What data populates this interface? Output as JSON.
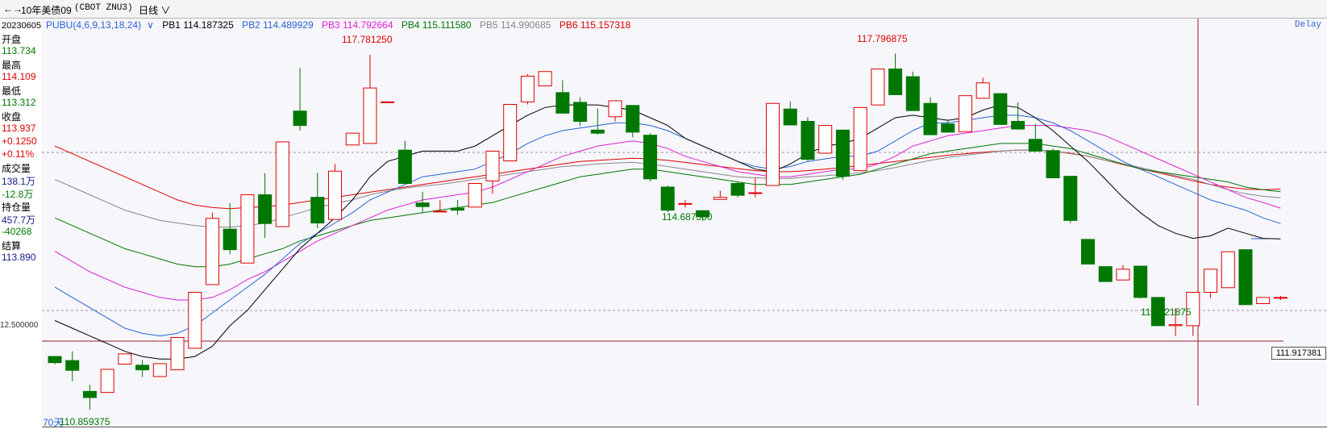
{
  "toolbar": {
    "instrument": "10年美债09",
    "code": "(CBOT ZNU3)",
    "period": "日线"
  },
  "info_panel": {
    "date": "20230605",
    "open_label": "开盘",
    "open_value": "113.734",
    "high_label": "最高",
    "high_value": "114.109",
    "low_label": "最低",
    "low_value": "113.312",
    "close_label": "收盘",
    "close_value": "113.937",
    "change": "+0.1250",
    "change_pct": "+0.11%",
    "volume_label": "成交量",
    "volume_value": "138.1万",
    "volume_change": "-12.8万",
    "oi_label": "持仓量",
    "oi_value": "457.7万",
    "oi_change": "-40268",
    "settle_label": "结算",
    "settle_value": "113.890"
  },
  "legend": {
    "name": "PUBU(4,6,9,13,18,24)",
    "pb1": "PB1 114.187325",
    "pb2": "PB2 114.489929",
    "pb3": "PB3 114.792664",
    "pb4": "PB4 115.111580",
    "pb5": "PB5 114.990685",
    "pb6": "PB6 115.157318"
  },
  "annotations": {
    "high1": "117.781250",
    "high2": "117.796875",
    "low_mid": "114.687500",
    "low_right": "112.921875",
    "low_left": "110.859375",
    "days_label": "70天",
    "axis_tick": "12.500000",
    "current_price": "111.917381",
    "delay": "Delay"
  },
  "colors": {
    "up": "#e00000",
    "down": "#007700",
    "pb1": "#000000",
    "pb2": "#2a64d6",
    "pb3": "#e020d0",
    "pb4": "#007700",
    "pb5": "#888888",
    "pb6": "#e00000",
    "bg": "#f6f6fb"
  },
  "chart_data": {
    "type": "candlestick",
    "ylim": [
      110.55,
      118.2
    ],
    "candles": [
      {
        "o": 111.9,
        "h": 111.9,
        "l": 111.75,
        "c": 111.78
      },
      {
        "o": 111.82,
        "h": 112.0,
        "l": 111.42,
        "c": 111.63
      },
      {
        "o": 111.22,
        "h": 111.35,
        "l": 110.86,
        "c": 111.1
      },
      {
        "o": 111.2,
        "h": 111.65,
        "l": 111.2,
        "c": 111.65
      },
      {
        "o": 111.75,
        "h": 111.95,
        "l": 111.75,
        "c": 111.95
      },
      {
        "o": 111.73,
        "h": 111.83,
        "l": 111.5,
        "c": 111.64
      },
      {
        "o": 111.51,
        "h": 111.76,
        "l": 111.51,
        "c": 111.76
      },
      {
        "o": 111.64,
        "h": 112.27,
        "l": 111.64,
        "c": 112.27
      },
      {
        "o": 112.06,
        "h": 113.15,
        "l": 112.06,
        "c": 113.15
      },
      {
        "o": 113.3,
        "h": 114.7,
        "l": 113.3,
        "c": 114.59
      },
      {
        "o": 114.38,
        "h": 114.89,
        "l": 113.89,
        "c": 113.98
      },
      {
        "o": 113.72,
        "h": 115.05,
        "l": 113.72,
        "c": 115.05
      },
      {
        "o": 115.05,
        "h": 115.47,
        "l": 114.21,
        "c": 114.49
      },
      {
        "o": 114.43,
        "h": 116.08,
        "l": 114.43,
        "c": 116.08
      },
      {
        "o": 116.68,
        "h": 117.52,
        "l": 116.3,
        "c": 116.4
      },
      {
        "o": 115.0,
        "h": 115.48,
        "l": 114.4,
        "c": 114.5
      },
      {
        "o": 114.57,
        "h": 115.65,
        "l": 114.57,
        "c": 115.51
      },
      {
        "o": 116.02,
        "h": 116.25,
        "l": 116.02,
        "c": 116.25
      },
      {
        "o": 116.05,
        "h": 117.78,
        "l": 116.05,
        "c": 117.13
      },
      {
        "o": 116.86,
        "h": 116.86,
        "l": 116.86,
        "c": 116.86
      },
      {
        "o": 115.92,
        "h": 116.1,
        "l": 115.27,
        "c": 115.27
      },
      {
        "o": 114.89,
        "h": 115.11,
        "l": 114.69,
        "c": 114.82
      },
      {
        "o": 114.73,
        "h": 114.94,
        "l": 114.73,
        "c": 114.73
      },
      {
        "o": 114.79,
        "h": 114.95,
        "l": 114.66,
        "c": 114.75
      },
      {
        "o": 114.81,
        "h": 115.27,
        "l": 114.81,
        "c": 115.27
      },
      {
        "o": 115.32,
        "h": 115.9,
        "l": 115.07,
        "c": 115.9
      },
      {
        "o": 115.71,
        "h": 116.81,
        "l": 115.71,
        "c": 116.81
      },
      {
        "o": 116.86,
        "h": 117.4,
        "l": 116.81,
        "c": 117.36
      },
      {
        "o": 117.17,
        "h": 117.45,
        "l": 117.17,
        "c": 117.45
      },
      {
        "o": 117.04,
        "h": 117.28,
        "l": 116.64,
        "c": 116.64
      },
      {
        "o": 116.85,
        "h": 116.95,
        "l": 116.39,
        "c": 116.48
      },
      {
        "o": 116.31,
        "h": 116.73,
        "l": 116.22,
        "c": 116.25
      },
      {
        "o": 116.57,
        "h": 116.88,
        "l": 116.48,
        "c": 116.88
      },
      {
        "o": 116.79,
        "h": 116.79,
        "l": 116.17,
        "c": 116.27
      },
      {
        "o": 116.21,
        "h": 116.25,
        "l": 115.31,
        "c": 115.36
      },
      {
        "o": 115.2,
        "h": 115.23,
        "l": 114.71,
        "c": 114.75
      },
      {
        "o": 114.88,
        "h": 114.95,
        "l": 114.8,
        "c": 114.88
      },
      {
        "o": 114.74,
        "h": 114.75,
        "l": 114.54,
        "c": 114.62
      },
      {
        "o": 114.96,
        "h": 115.13,
        "l": 114.96,
        "c": 115.0
      },
      {
        "o": 115.27,
        "h": 115.3,
        "l": 115.0,
        "c": 115.04
      },
      {
        "o": 115.09,
        "h": 115.38,
        "l": 115.0,
        "c": 115.09
      },
      {
        "o": 115.23,
        "h": 116.83,
        "l": 115.23,
        "c": 116.83
      },
      {
        "o": 116.72,
        "h": 116.87,
        "l": 116.41,
        "c": 116.41
      },
      {
        "o": 116.48,
        "h": 116.56,
        "l": 115.7,
        "c": 115.74
      },
      {
        "o": 115.86,
        "h": 116.4,
        "l": 115.86,
        "c": 116.4
      },
      {
        "o": 116.31,
        "h": 116.32,
        "l": 115.34,
        "c": 115.41
      },
      {
        "o": 115.52,
        "h": 116.75,
        "l": 115.52,
        "c": 116.75
      },
      {
        "o": 116.8,
        "h": 117.5,
        "l": 116.8,
        "c": 117.5
      },
      {
        "o": 117.5,
        "h": 117.8,
        "l": 117.0,
        "c": 117.0
      },
      {
        "o": 117.35,
        "h": 117.45,
        "l": 116.69,
        "c": 116.69
      },
      {
        "o": 116.83,
        "h": 116.95,
        "l": 116.22,
        "c": 116.22
      },
      {
        "o": 116.43,
        "h": 116.52,
        "l": 116.27,
        "c": 116.27
      },
      {
        "o": 116.28,
        "h": 116.98,
        "l": 116.28,
        "c": 116.98
      },
      {
        "o": 116.93,
        "h": 117.33,
        "l": 116.93,
        "c": 117.23
      },
      {
        "o": 117.02,
        "h": 117.02,
        "l": 116.42,
        "c": 116.42
      },
      {
        "o": 116.48,
        "h": 116.85,
        "l": 116.33,
        "c": 116.33
      },
      {
        "o": 116.13,
        "h": 116.43,
        "l": 115.9,
        "c": 115.9
      },
      {
        "o": 115.91,
        "h": 115.95,
        "l": 115.38,
        "c": 115.38
      },
      {
        "o": 115.41,
        "h": 115.41,
        "l": 114.5,
        "c": 114.55
      },
      {
        "o": 114.18,
        "h": 114.18,
        "l": 113.7,
        "c": 113.7
      },
      {
        "o": 113.65,
        "h": 113.65,
        "l": 113.36,
        "c": 113.36
      },
      {
        "o": 113.39,
        "h": 113.68,
        "l": 113.39,
        "c": 113.6
      },
      {
        "o": 113.66,
        "h": 113.66,
        "l": 113.03,
        "c": 113.05
      },
      {
        "o": 113.05,
        "h": 113.05,
        "l": 112.5,
        "c": 112.5
      },
      {
        "o": 112.5,
        "h": 112.84,
        "l": 112.3,
        "c": 112.52
      },
      {
        "o": 112.5,
        "h": 113.15,
        "l": 112.3,
        "c": 113.15
      },
      {
        "o": 113.15,
        "h": 113.6,
        "l": 113.04,
        "c": 113.6
      },
      {
        "o": 113.24,
        "h": 113.94,
        "l": 113.24,
        "c": 113.94
      },
      {
        "o": 113.98,
        "h": 113.98,
        "l": 112.91,
        "c": 112.91
      },
      {
        "o": 112.93,
        "h": 113.03,
        "l": 112.93,
        "c": 113.05
      },
      {
        "o": 113.05,
        "h": 113.08,
        "l": 113.0,
        "c": 113.05
      }
    ],
    "lines": {
      "PB1": [
        112.6,
        112.45,
        112.3,
        112.15,
        112.0,
        111.9,
        111.85,
        111.85,
        111.9,
        112.1,
        112.5,
        112.8,
        113.2,
        113.6,
        114.0,
        114.3,
        114.6,
        114.95,
        115.4,
        115.7,
        115.8,
        115.9,
        115.9,
        115.9,
        116.0,
        116.2,
        116.4,
        116.6,
        116.75,
        116.8,
        116.8,
        116.8,
        116.75,
        116.7,
        116.55,
        116.4,
        116.15,
        116.0,
        115.85,
        115.7,
        115.55,
        115.5,
        115.65,
        115.85,
        116.0,
        116.05,
        116.15,
        116.35,
        116.55,
        116.6,
        116.55,
        116.5,
        116.55,
        116.7,
        116.8,
        116.75,
        116.55,
        116.3,
        116.0,
        115.7,
        115.35,
        115.0,
        114.7,
        114.45,
        114.3,
        114.2,
        114.25,
        114.4,
        114.3,
        114.2,
        114.19
      ],
      "PB2": [
        113.25,
        113.05,
        112.85,
        112.65,
        112.45,
        112.35,
        112.3,
        112.35,
        112.5,
        112.75,
        113.0,
        113.25,
        113.5,
        113.8,
        114.1,
        114.3,
        114.5,
        114.7,
        114.95,
        115.1,
        115.25,
        115.4,
        115.45,
        115.5,
        115.55,
        115.7,
        115.85,
        116.05,
        116.2,
        116.3,
        116.35,
        116.4,
        116.45,
        116.45,
        116.4,
        116.3,
        116.15,
        116.0,
        115.85,
        115.7,
        115.6,
        115.55,
        115.6,
        115.7,
        115.75,
        115.8,
        115.8,
        115.9,
        116.1,
        116.3,
        116.45,
        116.45,
        116.5,
        116.55,
        116.6,
        116.6,
        116.55,
        116.45,
        116.3,
        116.1,
        115.9,
        115.7,
        115.55,
        115.4,
        115.25,
        115.1,
        114.95,
        114.85,
        114.75,
        114.6,
        114.49
      ],
      "PB3": [
        113.95,
        113.75,
        113.55,
        113.4,
        113.25,
        113.15,
        113.05,
        113.0,
        113.0,
        113.05,
        113.2,
        113.4,
        113.55,
        113.75,
        113.95,
        114.15,
        114.3,
        114.45,
        114.6,
        114.75,
        114.85,
        114.95,
        115.0,
        115.05,
        115.1,
        115.2,
        115.35,
        115.5,
        115.65,
        115.8,
        115.9,
        116.0,
        116.05,
        116.1,
        116.05,
        115.95,
        115.8,
        115.7,
        115.6,
        115.5,
        115.45,
        115.4,
        115.4,
        115.45,
        115.5,
        115.55,
        115.55,
        115.65,
        115.8,
        116.0,
        116.1,
        116.2,
        116.25,
        116.3,
        116.35,
        116.4,
        116.4,
        116.4,
        116.35,
        116.3,
        116.2,
        116.05,
        115.9,
        115.75,
        115.6,
        115.45,
        115.3,
        115.15,
        115.0,
        114.9,
        114.79
      ],
      "PB4": [
        114.6,
        114.45,
        114.3,
        114.15,
        114.0,
        113.9,
        113.8,
        113.7,
        113.65,
        113.65,
        113.7,
        113.8,
        113.9,
        114.0,
        114.15,
        114.25,
        114.35,
        114.45,
        114.55,
        114.6,
        114.65,
        114.7,
        114.75,
        114.8,
        114.85,
        114.9,
        115.0,
        115.1,
        115.2,
        115.3,
        115.4,
        115.45,
        115.5,
        115.55,
        115.55,
        115.5,
        115.45,
        115.4,
        115.35,
        115.3,
        115.25,
        115.25,
        115.25,
        115.3,
        115.35,
        115.4,
        115.45,
        115.55,
        115.65,
        115.75,
        115.85,
        115.9,
        115.95,
        116.0,
        116.05,
        116.05,
        116.05,
        116.0,
        115.95,
        115.85,
        115.75,
        115.65,
        115.55,
        115.5,
        115.45,
        115.4,
        115.35,
        115.3,
        115.2,
        115.15,
        115.11
      ],
      "PB5": [
        115.35,
        115.2,
        115.05,
        114.9,
        114.75,
        114.65,
        114.55,
        114.5,
        114.45,
        114.42,
        114.42,
        114.45,
        114.5,
        114.6,
        114.7,
        114.8,
        114.88,
        114.95,
        115.05,
        115.12,
        115.18,
        115.22,
        115.25,
        115.3,
        115.35,
        115.4,
        115.45,
        115.5,
        115.55,
        115.6,
        115.62,
        115.65,
        115.67,
        115.68,
        115.65,
        115.6,
        115.55,
        115.5,
        115.45,
        115.4,
        115.38,
        115.37,
        115.37,
        115.4,
        115.42,
        115.45,
        115.48,
        115.52,
        115.58,
        115.65,
        115.72,
        115.78,
        115.82,
        115.86,
        115.9,
        115.92,
        115.92,
        115.9,
        115.85,
        115.8,
        115.72,
        115.65,
        115.58,
        115.5,
        115.42,
        115.35,
        115.25,
        115.15,
        115.07,
        115.02,
        114.99
      ],
      "PB6": [
        116.0,
        115.85,
        115.7,
        115.55,
        115.4,
        115.25,
        115.1,
        114.95,
        114.85,
        114.8,
        114.78,
        114.8,
        114.82,
        114.85,
        114.9,
        114.95,
        115.0,
        115.05,
        115.1,
        115.15,
        115.2,
        115.25,
        115.3,
        115.35,
        115.4,
        115.45,
        115.5,
        115.55,
        115.6,
        115.65,
        115.7,
        115.72,
        115.74,
        115.76,
        115.75,
        115.72,
        115.68,
        115.64,
        115.6,
        115.56,
        115.52,
        115.5,
        115.5,
        115.52,
        115.55,
        115.58,
        115.62,
        115.66,
        115.7,
        115.74,
        115.78,
        115.82,
        115.85,
        115.88,
        115.9,
        115.92,
        115.92,
        115.9,
        115.86,
        115.8,
        115.72,
        115.64,
        115.56,
        115.48,
        115.4,
        115.32,
        115.25,
        115.2,
        115.16,
        115.15,
        115.16
      ]
    }
  }
}
